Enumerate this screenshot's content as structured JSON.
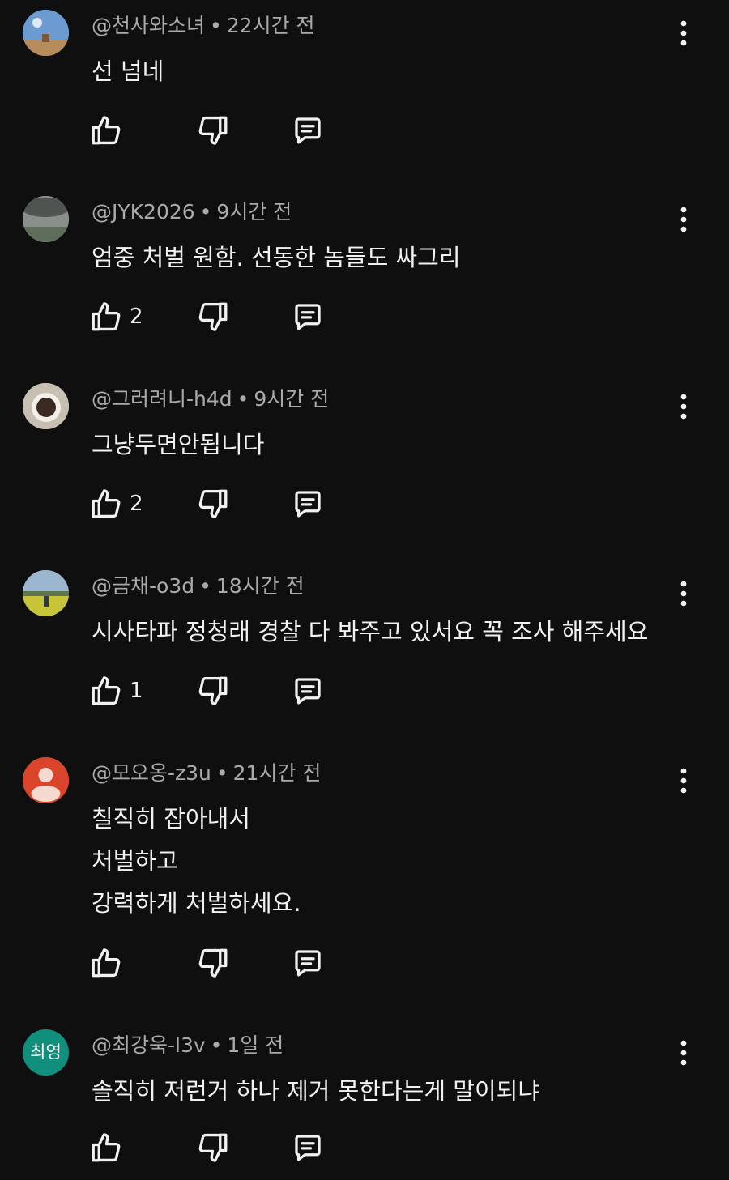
{
  "comments": [
    {
      "author": "@천사와소녀",
      "time": "22시간 전",
      "text_lines": [
        "선 넘네"
      ],
      "likes": "",
      "avatar_icon": "landscape-photo",
      "avatar_colors": [
        "#6c9bd2",
        "#b58c5a"
      ]
    },
    {
      "author": "@JYK2026",
      "time": "9시간 전",
      "text_lines": [
        "엄중 처벌 원함. 선동한 놈들도 싸그리"
      ],
      "likes": "2",
      "avatar_icon": "foggy-photo",
      "avatar_colors": [
        "#8a8f8c",
        "#5f6e5c"
      ]
    },
    {
      "author": "@그러려니-h4d",
      "time": "9시간 전",
      "text_lines": [
        "그냥두면안됩니다"
      ],
      "likes": "2",
      "avatar_icon": "coffee-cup-photo",
      "avatar_colors": [
        "#c8bfb3",
        "#3b2a22"
      ]
    },
    {
      "author": "@금채-o3d",
      "time": "18시간 전",
      "text_lines": [
        "시사타파 정청래 경찰 다 봐주고 있서요 꼭 조사 해주세요"
      ],
      "likes": "1",
      "avatar_icon": "field-photo",
      "avatar_colors": [
        "#9db6cf",
        "#c8c43a"
      ]
    },
    {
      "author": "@모오옹-z3u",
      "time": "21시간 전",
      "text_lines": [
        "칠직히 잡아내서",
        "처벌하고",
        "강력하게 처벌하세요."
      ],
      "likes": "",
      "avatar_icon": "default-person-icon",
      "avatar_colors": [
        "#d9442b",
        "#f4d9cf"
      ]
    },
    {
      "author": "@최강욱-l3v",
      "time": "1일 전",
      "text_lines": [
        "솔직히 저런거 하나 제거 못한다는게 말이되냐"
      ],
      "likes": "",
      "avatar_icon": "initials",
      "avatar_text": "최영",
      "avatar_colors": [
        "#0f8f7c",
        "#ffffff"
      ]
    }
  ]
}
